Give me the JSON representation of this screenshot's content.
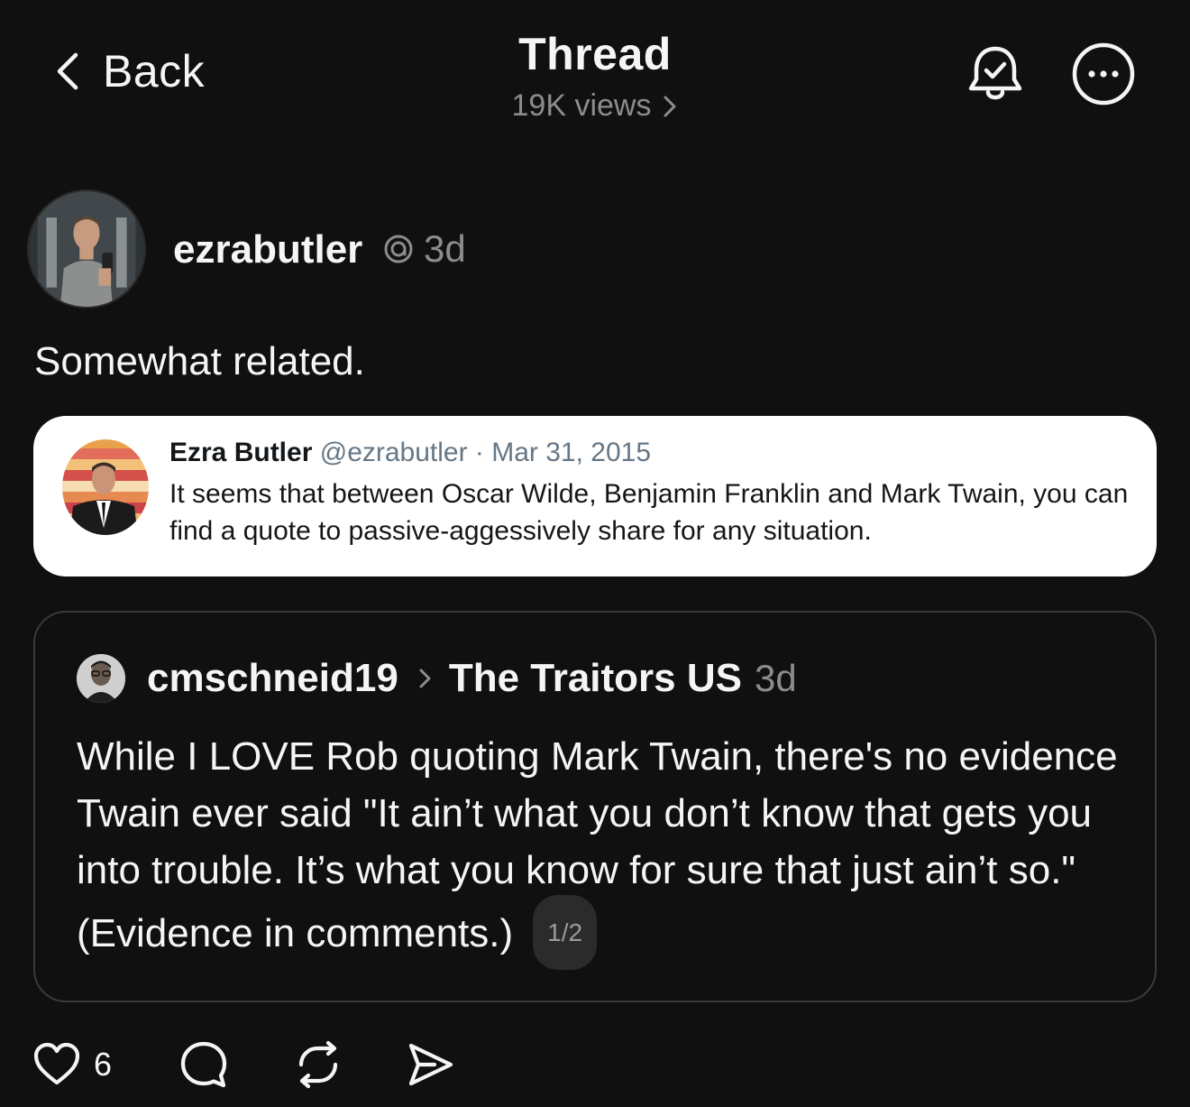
{
  "header": {
    "back_label": "Back",
    "title": "Thread",
    "views": "19K views"
  },
  "post": {
    "username": "ezrabutler",
    "time": "3d",
    "text": "Somewhat related."
  },
  "embedded_tweet": {
    "name": "Ezra Butler",
    "meta": "@ezrabutler · Mar 31, 2015",
    "line1": "It seems that between Oscar Wilde, Benjamin Franklin and Mark Twain, you can",
    "line2": "find a quote to passive-aggessively share for any situation."
  },
  "quoted_post": {
    "username": "cmschneid19",
    "community": "The Traitors US",
    "time": "3d",
    "text": "While I LOVE Rob quoting Mark Twain, there's no evidence Twain ever said \"It ain’t what you don’t know that gets you into trouble. It’s what you know for sure that just ain’t so.\" (Evidence in comments.)",
    "pager": "1/2"
  },
  "actions": {
    "like_count": "6"
  },
  "icons": {
    "back": "chevron-left-icon",
    "views_chevron": "chevron-right-icon",
    "notify": "bell-check-icon",
    "more": "more-horizontal-icon",
    "thread": "threads-logo-icon",
    "like": "heart-icon",
    "reply": "comment-icon",
    "repost": "repost-icon",
    "share": "send-icon"
  },
  "colors": {
    "background": "#101010",
    "text": "#f3f5f7",
    "secondary": "#8c8c8c",
    "border": "#3a3a3a"
  }
}
